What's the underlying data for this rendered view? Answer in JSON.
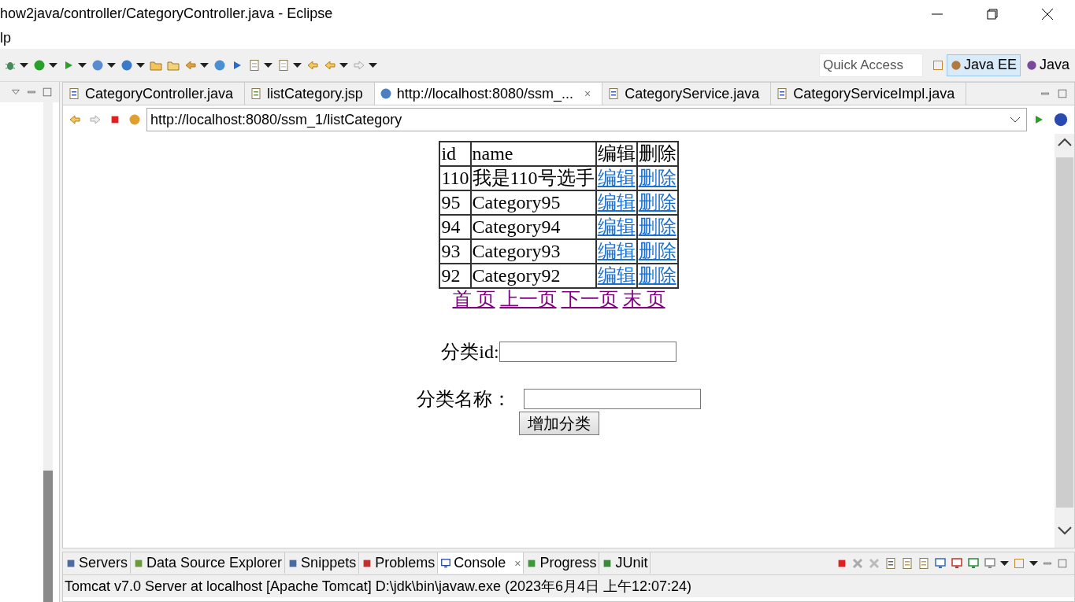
{
  "window": {
    "title": "how2java/controller/CategoryController.java - Eclipse"
  },
  "menu": [
    "lp"
  ],
  "quick_access": {
    "placeholder": "Quick Access"
  },
  "perspectives": [
    {
      "label": "Java EE",
      "selected": true
    },
    {
      "label": "Java",
      "selected": false
    }
  ],
  "editor_tabs": [
    {
      "label": "CategoryController.java",
      "kind": "java",
      "selected": false
    },
    {
      "label": "listCategory.jsp",
      "kind": "jsp",
      "selected": false
    },
    {
      "label": "http://localhost:8080/ssm_...",
      "kind": "web",
      "selected": true,
      "close": "×"
    },
    {
      "label": "CategoryService.java",
      "kind": "java",
      "selected": false
    },
    {
      "label": "CategoryServiceImpl.java",
      "kind": "java",
      "selected": false
    }
  ],
  "address": {
    "value": "http://localhost:8080/ssm_1/listCategory"
  },
  "table": {
    "columns": [
      "id",
      "name",
      "编辑",
      "删除"
    ],
    "rows": [
      {
        "id": "110",
        "name": "我是110号选手",
        "edit": "编辑",
        "delete": "删除"
      },
      {
        "id": "95",
        "name": "Category95",
        "edit": "编辑",
        "delete": "删除"
      },
      {
        "id": "94",
        "name": "Category94",
        "edit": "编辑",
        "delete": "删除"
      },
      {
        "id": "93",
        "name": "Category93",
        "edit": "编辑",
        "delete": "删除"
      },
      {
        "id": "92",
        "name": "Category92",
        "edit": "编辑",
        "delete": "删除"
      }
    ]
  },
  "pager": [
    "首 页",
    "上一页",
    "下一页",
    "末 页"
  ],
  "form": {
    "id_label": "分类id:",
    "name_label": "分类名称：",
    "submit": "增加分类"
  },
  "bottom_tabs": [
    {
      "label": "Servers",
      "selected": false
    },
    {
      "label": "Data Source Explorer",
      "selected": false
    },
    {
      "label": "Snippets",
      "selected": false
    },
    {
      "label": "Problems",
      "selected": false
    },
    {
      "label": "Console",
      "selected": true,
      "close": "×"
    },
    {
      "label": "Progress",
      "selected": false
    },
    {
      "label": "JUnit",
      "selected": false
    }
  ],
  "console": {
    "header": "Tomcat v7.0 Server at localhost [Apache Tomcat] D:\\jdk\\bin\\javaw.exe (2023年6月4日 上午12:07:24)"
  }
}
